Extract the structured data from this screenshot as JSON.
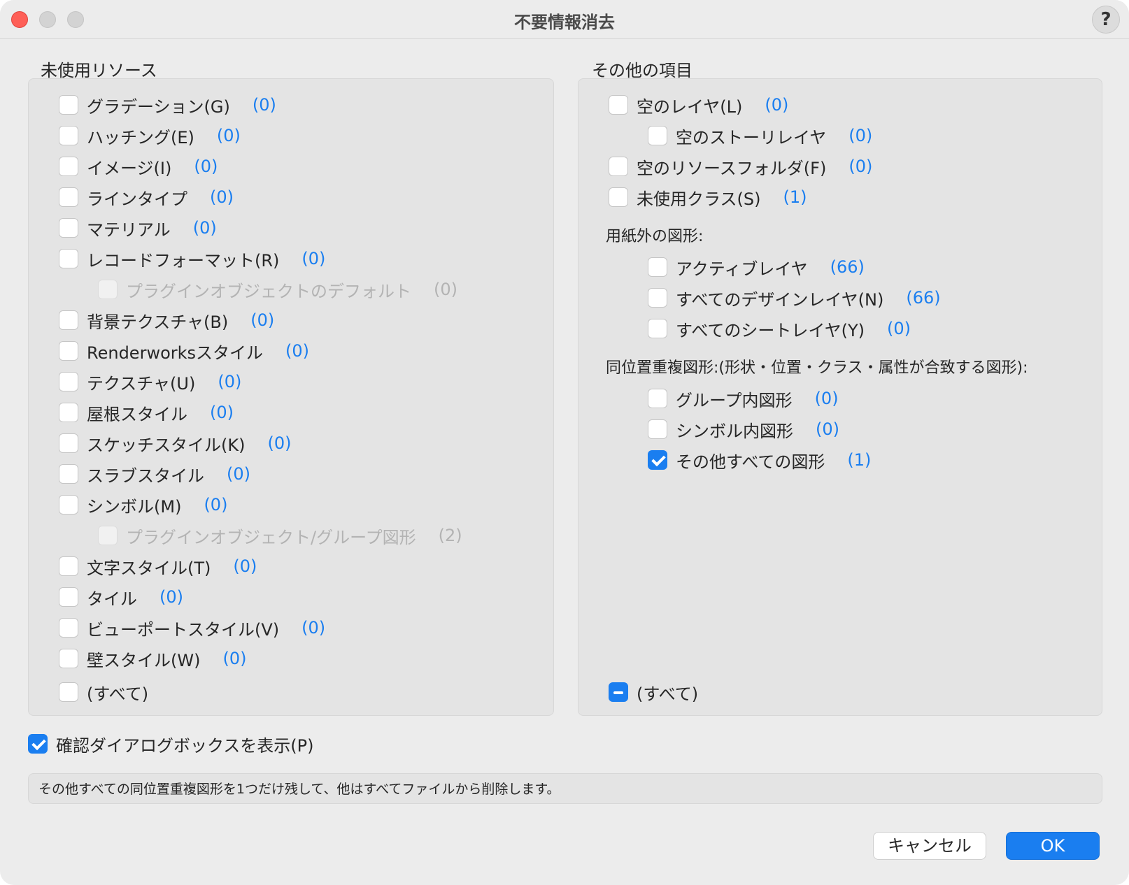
{
  "window": {
    "title": "不要情報消去",
    "help_label": "?"
  },
  "left_panel": {
    "title": "未使用リソース",
    "items": [
      {
        "label": "グラデーション(G)",
        "count": "(0)"
      },
      {
        "label": "ハッチング(E)",
        "count": "(0)"
      },
      {
        "label": "イメージ(I)",
        "count": "(0)"
      },
      {
        "label": "ラインタイプ",
        "count": "(0)"
      },
      {
        "label": "マテリアル",
        "count": "(0)"
      },
      {
        "label": "レコードフォーマット(R)",
        "count": "(0)"
      },
      {
        "label": "プラグインオブジェクトのデフォルト",
        "count": "(0)",
        "state": "disabled"
      },
      {
        "label": "背景テクスチャ(B)",
        "count": "(0)"
      },
      {
        "label": "Renderworksスタイル",
        "count": "(0)"
      },
      {
        "label": "テクスチャ(U)",
        "count": "(0)"
      },
      {
        "label": "屋根スタイル",
        "count": "(0)"
      },
      {
        "label": "スケッチスタイル(K)",
        "count": "(0)"
      },
      {
        "label": "スラブスタイル",
        "count": "(0)"
      },
      {
        "label": "シンボル(M)",
        "count": "(0)"
      },
      {
        "label": "プラグインオブジェクト/グループ図形",
        "count": "(2)",
        "state": "disabled"
      },
      {
        "label": "文字スタイル(T)",
        "count": "(0)"
      },
      {
        "label": "タイル",
        "count": "(0)"
      },
      {
        "label": "ビューポートスタイル(V)",
        "count": "(0)"
      },
      {
        "label": "壁スタイル(W)",
        "count": "(0)"
      }
    ],
    "all_label": "(すべて)",
    "all_state": "unchecked"
  },
  "right_panel": {
    "title": "その他の項目",
    "items": [
      {
        "label": "空のレイヤ(L)",
        "count": "(0)"
      },
      {
        "label": "空のストーリレイヤ",
        "count": "(0)"
      },
      {
        "label": "空のリソースフォルダ(F)",
        "count": "(0)"
      },
      {
        "label": "未使用クラス(S)",
        "count": "(1)"
      }
    ],
    "offpaper_heading": "用紙外の図形:",
    "offpaper_items": [
      {
        "label": "アクティブレイヤ",
        "count": "(66)"
      },
      {
        "label": "すべてのデザインレイヤ(N)",
        "count": "(66)"
      },
      {
        "label": "すべてのシートレイヤ(Y)",
        "count": "(0)"
      }
    ],
    "duplicate_heading": "同位置重複図形:(形状・位置・クラス・属性が合致する図形):",
    "duplicate_items": [
      {
        "label": "グループ内図形",
        "count": "(0)"
      },
      {
        "label": "シンボル内図形",
        "count": "(0)"
      },
      {
        "label": "その他すべての図形",
        "count": "(1)",
        "state": "checked"
      }
    ],
    "all_label": "(すべて)",
    "all_state": "mixed"
  },
  "confirm": {
    "label": "確認ダイアログボックスを表示(P)",
    "state": "checked"
  },
  "message": "その他すべての同位置重複図形を1つだけ残して、他はすべてファイルから削除します。",
  "buttons": {
    "cancel": "キャンセル",
    "ok": "OK"
  },
  "colors": {
    "accent": "#1a7ef0",
    "close": "#fe5f57"
  }
}
